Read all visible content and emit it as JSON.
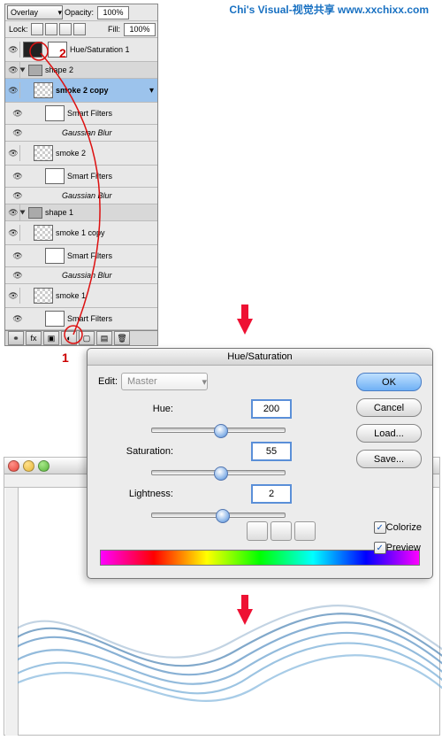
{
  "watermark": "Chi's Visual-视觉共享  www.xxchixx.com",
  "panel": {
    "blend_mode": "Overlay",
    "opacity_label": "Opacity:",
    "opacity_value": "100%",
    "lock_label": "Lock:",
    "fill_label": "Fill:",
    "fill_value": "100%",
    "adj": "Hue/Saturation 1",
    "groups": [
      "shape 2",
      "shape 1"
    ],
    "layers": [
      "smoke 2 copy",
      "smoke 2",
      "smoke 1 copy",
      "smoke 1"
    ],
    "sf": "Smart Filters",
    "gb": "Gaussian Blur"
  },
  "ann": {
    "one": "1",
    "two": "2"
  },
  "dlg": {
    "title": "Hue/Saturation",
    "edit_label": "Edit:",
    "edit_value": "Master",
    "hue_label": "Hue:",
    "hue_value": "200",
    "sat_label": "Saturation:",
    "sat_value": "55",
    "lig_label": "Lightness:",
    "lig_value": "2",
    "ok": "OK",
    "cancel": "Cancel",
    "load": "Load...",
    "save": "Save...",
    "colorize": "Colorize",
    "preview": "Preview"
  },
  "chart_data": {
    "type": "table",
    "title": "Hue/Saturation adjustment values",
    "rows": [
      {
        "param": "Hue",
        "value": 200,
        "range": [
          -180,
          180
        ]
      },
      {
        "param": "Saturation",
        "value": 55,
        "range": [
          -100,
          100
        ]
      },
      {
        "param": "Lightness",
        "value": 2,
        "range": [
          -100,
          100
        ]
      }
    ],
    "colorize": true
  }
}
